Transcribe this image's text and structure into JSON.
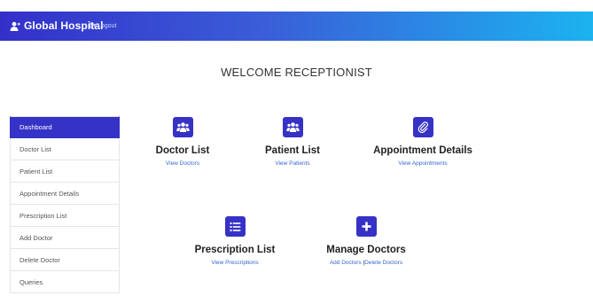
{
  "navbar": {
    "brand": "Global Hospital",
    "logout": "Logout",
    "brand_icon": "user-plus-icon",
    "logout_icon": "sign-out-icon"
  },
  "welcome": "WELCOME RECEPTIONIST",
  "sidebar": {
    "items": [
      {
        "label": "Dashboard",
        "active": true
      },
      {
        "label": "Doctor List"
      },
      {
        "label": "Patient List"
      },
      {
        "label": "Appointment Details"
      },
      {
        "label": "Prescription List"
      },
      {
        "label": "Add Doctor"
      },
      {
        "label": "Delete Doctor"
      },
      {
        "label": "Queries"
      }
    ]
  },
  "cards": {
    "doctor_list": {
      "title": "Doctor List",
      "link": "View Doctors",
      "icon": "users-icon"
    },
    "patient_list": {
      "title": "Patient List",
      "link": "View Patients",
      "icon": "users-icon"
    },
    "appointment_details": {
      "title": "Appointment Details",
      "link": "View Appointments",
      "icon": "paperclip-icon"
    },
    "prescription_list": {
      "title": "Prescription List",
      "link": "View Prescriptions",
      "icon": "list-icon"
    },
    "manage_doctors": {
      "title": "Manage Doctors",
      "link_add": "Add Doctors",
      "separator": "|",
      "link_delete": "Delete Doctors",
      "icon": "plus-icon"
    }
  },
  "colors": {
    "accent": "#3532c8",
    "nav_gradient_start": "#3330c9",
    "nav_gradient_end": "#1bb3f0",
    "link": "#3567d3"
  }
}
